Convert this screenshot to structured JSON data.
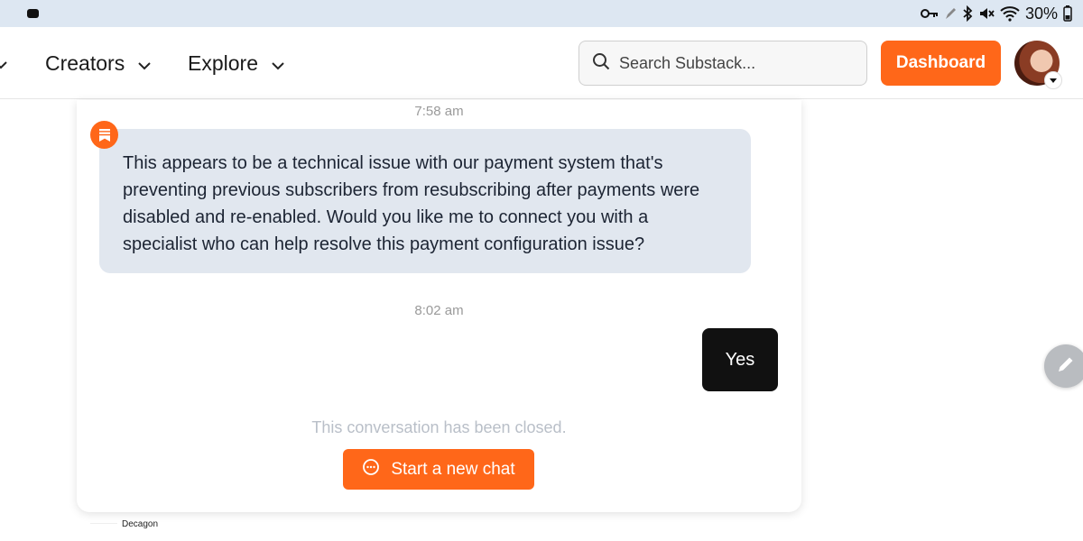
{
  "status_bar": {
    "battery_text": "30%",
    "icons": [
      "camera-icon",
      "key-icon",
      "pen-icon",
      "bluetooth-icon",
      "mute-icon",
      "wifi-icon",
      "battery-icon"
    ]
  },
  "nav": {
    "items": [
      {
        "label": "Creators",
        "icon": "chevron-down-icon"
      },
      {
        "label": "Explore",
        "icon": "chevron-down-icon"
      }
    ],
    "search": {
      "placeholder": "Search Substack...",
      "value": ""
    },
    "dashboard_label": "Dashboard"
  },
  "chat": {
    "messages": [
      {
        "time": "7:58 am",
        "sender": "bot",
        "text": "This appears to be a technical issue with our payment system that's preventing previous subscribers from resubscribing after payments were disabled and re-enabled. Would you like me to connect you with a specialist who can help resolve this payment configuration issue?"
      },
      {
        "time": "8:02 am",
        "sender": "user",
        "text": "Yes"
      }
    ],
    "closed_text": "This conversation has been closed.",
    "new_chat_label": "Start a new chat"
  },
  "footer": {
    "brand": "Decagon"
  },
  "colors": {
    "accent": "#ff6719",
    "bot_bubble": "#e1e7ef",
    "user_bubble": "#111111",
    "status_bar": "#dde7f2"
  }
}
